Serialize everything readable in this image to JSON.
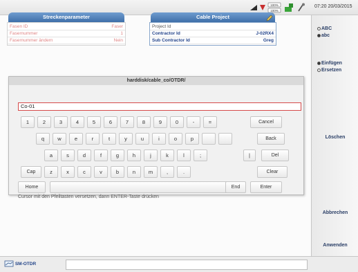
{
  "status": {
    "battery_top": "100%",
    "battery_bottom": "100%",
    "datetime": "07:20 20/03/2015"
  },
  "strecke": {
    "title": "Streckenparameter",
    "rows": [
      {
        "key": "Fasen ID",
        "value": "Faser"
      },
      {
        "key": "Fasernummer",
        "value": "1"
      },
      {
        "key": "Fasernummer ändern",
        "value": "Nein"
      }
    ]
  },
  "cable": {
    "title": "Cable Project",
    "rows": [
      {
        "key": "Project Id",
        "value": ""
      },
      {
        "key": "Contractor Id",
        "value": "J-02RX4"
      },
      {
        "key": "Sub Contractor Id",
        "value": "Greg"
      }
    ]
  },
  "dialog": {
    "title": "harddisk/cable_co/OTDR/",
    "input_value": "Co-01",
    "hint": "Cursor mit den Pfeiltasten versetzen, dann ENTER-Taste drücken"
  },
  "keys": {
    "row1": [
      "1",
      "2",
      "3",
      "4",
      "5",
      "6",
      "7",
      "8",
      "9",
      "0",
      "-",
      "="
    ],
    "row2": [
      "q",
      "w",
      "e",
      "r",
      "t",
      "y",
      "u",
      "i",
      "o",
      "p",
      "",
      ""
    ],
    "row3": [
      "a",
      "s",
      "d",
      "f",
      "g",
      "h",
      "j",
      "k",
      "l",
      ";",
      "|"
    ],
    "row4": [
      "z",
      "x",
      "c",
      "v",
      "b",
      "n",
      "m",
      ",",
      "."
    ],
    "cancel": "Cancel",
    "back": "Back",
    "del": "Del",
    "cap": "Cap",
    "clear": "Clear",
    "home": "Home",
    "end": "End",
    "enter": "Enter"
  },
  "side": {
    "case_options": [
      "ABC",
      "abc"
    ],
    "case_selected": 1,
    "mode_options": [
      "Einfügen",
      "Ersetzen"
    ],
    "mode_selected": 0,
    "buttons": {
      "delete": "Löschen",
      "abort": "Abbrechen",
      "apply": "Anwenden"
    }
  },
  "bottom": {
    "tab_label": "SM-OTDR"
  },
  "colors": {
    "accent": "#3f6fa9",
    "input_border": "#d64a4a",
    "label": "#2a3e66"
  }
}
